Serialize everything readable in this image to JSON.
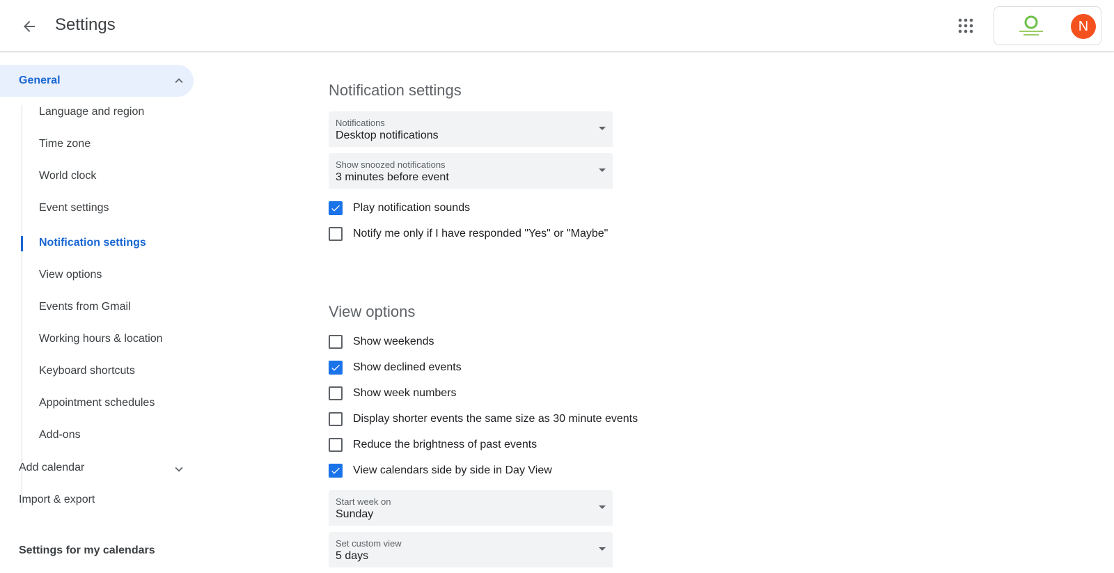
{
  "header": {
    "title": "Settings",
    "avatar_initial": "N",
    "avatar_color": "#f4511e",
    "icons": {
      "back": "arrow-back-icon",
      "apps": "apps-grid-icon"
    }
  },
  "sidebar": {
    "general_label": "General",
    "general_items": [
      {
        "label": "Language and region",
        "active": false
      },
      {
        "label": "Time zone",
        "active": false
      },
      {
        "label": "World clock",
        "active": false
      },
      {
        "label": "Event settings",
        "active": false
      },
      {
        "label": "Notification settings",
        "active": true
      },
      {
        "label": "View options",
        "active": false
      },
      {
        "label": "Events from Gmail",
        "active": false
      },
      {
        "label": "Working hours & location",
        "active": false
      },
      {
        "label": "Keyboard shortcuts",
        "active": false
      },
      {
        "label": "Appointment schedules",
        "active": false
      },
      {
        "label": "Add-ons",
        "active": false
      }
    ],
    "add_calendar": "Add calendar",
    "import_export": "Import & export",
    "my_calendars": "Settings for my calendars"
  },
  "notification_settings": {
    "title": "Notification settings",
    "notifications": {
      "label": "Notifications",
      "value": "Desktop notifications"
    },
    "snoozed": {
      "label": "Show snoozed notifications",
      "value": "3 minutes before event"
    },
    "checkboxes": [
      {
        "label": "Play notification sounds",
        "checked": true
      },
      {
        "label": "Notify me only if I have responded \"Yes\" or \"Maybe\"",
        "checked": false
      }
    ]
  },
  "view_options": {
    "title": "View options",
    "checkboxes": [
      {
        "label": "Show weekends",
        "checked": false
      },
      {
        "label": "Show declined events",
        "checked": true
      },
      {
        "label": "Show week numbers",
        "checked": false
      },
      {
        "label": "Display shorter events the same size as 30 minute events",
        "checked": false
      },
      {
        "label": "Reduce the brightness of past events",
        "checked": false
      },
      {
        "label": "View calendars side by side in Day View",
        "checked": true
      }
    ],
    "start_week": {
      "label": "Start week on",
      "value": "Sunday"
    },
    "custom_view": {
      "label": "Set custom view",
      "value": "5 days"
    }
  },
  "colors": {
    "accent": "#1967d2",
    "checkbox": "#1a73e8",
    "selected_bg": "#e8f0fe"
  }
}
